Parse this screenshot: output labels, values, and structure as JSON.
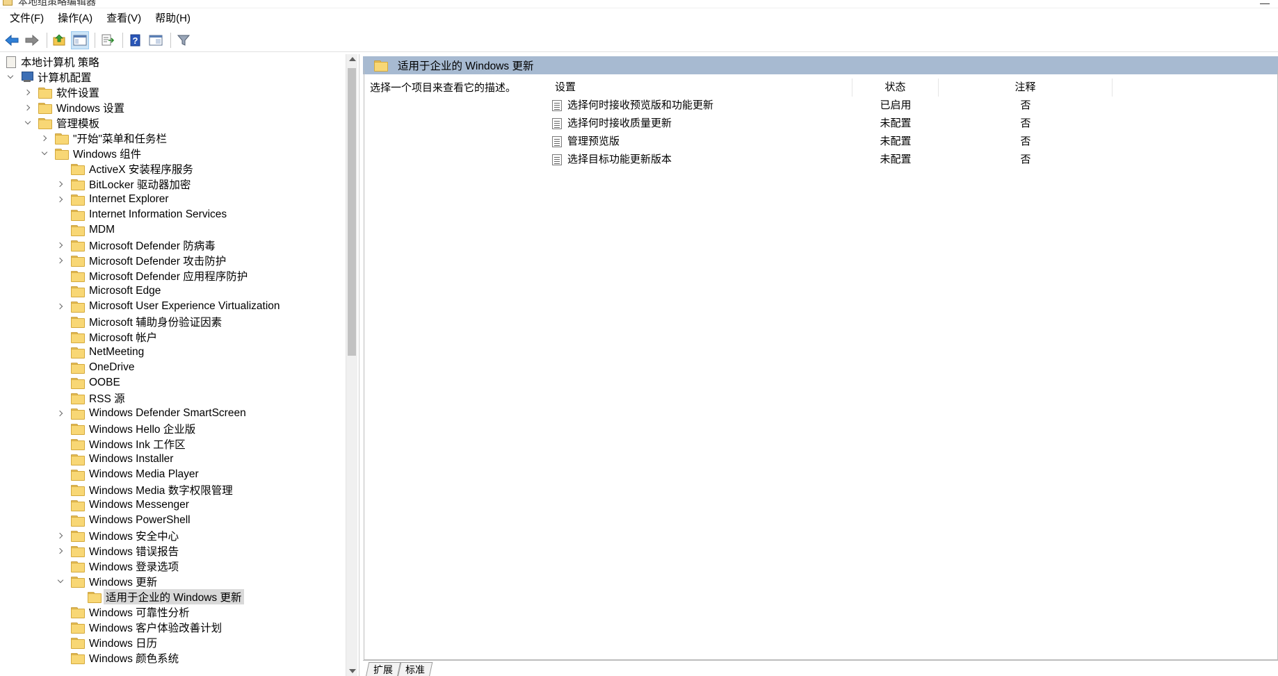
{
  "window": {
    "title": "本地组策略编辑器"
  },
  "menubar": {
    "items": [
      "文件(F)",
      "操作(A)",
      "查看(V)",
      "帮助(H)"
    ]
  },
  "toolbar": {
    "buttons": [
      "back-icon",
      "forward-icon",
      "up-folder-icon",
      "show-hide-tree-icon",
      "export-list-icon",
      "help-icon",
      "properties-icon",
      "filter-icon"
    ]
  },
  "tree": {
    "root": "本地计算机 策略",
    "computer_config": "计算机配置",
    "software_settings": "软件设置",
    "windows_settings": "Windows 设置",
    "admin_templates": "管理模板",
    "start_menu": "\"开始\"菜单和任务栏",
    "windows_components": "Windows 组件",
    "components": [
      "ActiveX 安装程序服务",
      "BitLocker 驱动器加密",
      "Internet Explorer",
      "Internet Information Services",
      "MDM",
      "Microsoft Defender 防病毒",
      "Microsoft Defender 攻击防护",
      "Microsoft Defender 应用程序防护",
      "Microsoft Edge",
      "Microsoft User Experience Virtualization",
      "Microsoft 辅助身份验证因素",
      "Microsoft 帐户",
      "NetMeeting",
      "OneDrive",
      "OOBE",
      "RSS 源",
      "Windows Defender SmartScreen",
      "Windows Hello 企业版",
      "Windows Ink 工作区",
      "Windows Installer",
      "Windows Media Player",
      "Windows Media 数字权限管理",
      "Windows Messenger",
      "Windows PowerShell",
      "Windows 安全中心",
      "Windows 错误报告",
      "Windows 登录选项",
      "Windows 更新"
    ],
    "selected": "适用于企业的 Windows 更新",
    "after": [
      "Windows 可靠性分析",
      "Windows 客户体验改善计划",
      "Windows 日历",
      "Windows 颜色系统"
    ]
  },
  "right_pane": {
    "title": "适用于企业的 Windows 更新",
    "description": "选择一个项目来查看它的描述。",
    "columns": [
      "设置",
      "状态",
      "注释"
    ],
    "rows": [
      {
        "setting": "选择何时接收预览版和功能更新",
        "state": "已启用",
        "comment": "否"
      },
      {
        "setting": "选择何时接收质量更新",
        "state": "未配置",
        "comment": "否"
      },
      {
        "setting": "管理预览版",
        "state": "未配置",
        "comment": "否"
      },
      {
        "setting": "选择目标功能更新版本",
        "state": "未配置",
        "comment": "否"
      }
    ]
  },
  "bottom_tabs": [
    "扩展",
    "标准"
  ]
}
